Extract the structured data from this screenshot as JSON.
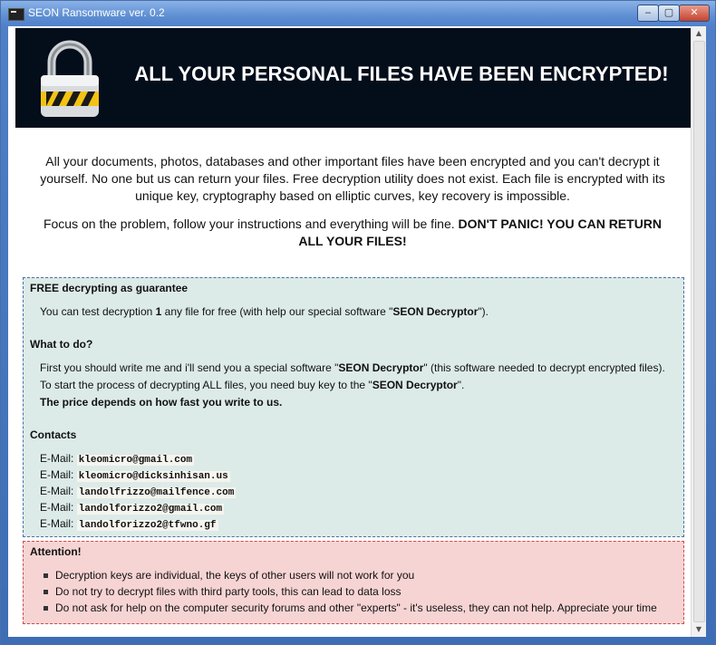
{
  "window": {
    "title": "SEON Ransomware ver. 0.2",
    "controls": {
      "minimize": "‒",
      "maximize": "▢",
      "close": "✕"
    }
  },
  "banner": {
    "headline": "ALL YOUR PERSONAL FILES HAVE BEEN ENCRYPTED!",
    "icon": "padlock-icon"
  },
  "intro": {
    "p1": "All your documents, photos, databases and other important files have been encrypted and you can't decrypt it yourself. No one but us can return your files. Free decryption utility does not exist. Each file is encrypted with its unique key, cryptography based on elliptic curves, key recovery is impossible.",
    "p2_a": "Focus on the problem, follow your instructions and everything will be fine. ",
    "p2_b": "DON'T PANIC! YOU CAN RETURN ALL YOUR FILES!"
  },
  "free": {
    "heading": "FREE decrypting as guarantee",
    "l1_a": "You can test decryption ",
    "l1_num": "1",
    "l1_b": " any file for free (with help our special software \"",
    "l1_tool": "SEON Decryptor",
    "l1_c": "\")."
  },
  "todo": {
    "heading": "What to do?",
    "l1_a": "First you should write me and i'll send you a special software \"",
    "l1_tool": "SEON Decryptor",
    "l1_b": "\" (this software needed to decrypt encrypted files).",
    "l2_a": "To start the process of decrypting ALL files, you need buy key to the \"",
    "l2_tool": "SEON Decryptor",
    "l2_b": "\".",
    "l3": "The price depends on how fast you write to us."
  },
  "contacts": {
    "heading": "Contacts",
    "label": "E-Mail:",
    "emails": [
      "kleomicro@gmail.com",
      "kleomicro@dicksinhisan.us",
      "landolfrizzo@mailfence.com",
      "landolforizzo2@gmail.com",
      "landolforizzo2@tfwno.gf"
    ]
  },
  "attention": {
    "heading": "Attention!",
    "items": [
      "Decryption keys are individual, the keys of other users will not work for you",
      "Do not try to decrypt files with third party tools, this can lead to data loss",
      "Do not ask for help on the computer security forums and other \"experts\" - it's useless, they can not help. Appreciate your time"
    ]
  },
  "colors": {
    "banner_bg": "#040d1a",
    "info_box_bg": "#dcebe8",
    "attention_box_bg": "#f7d4d4"
  }
}
